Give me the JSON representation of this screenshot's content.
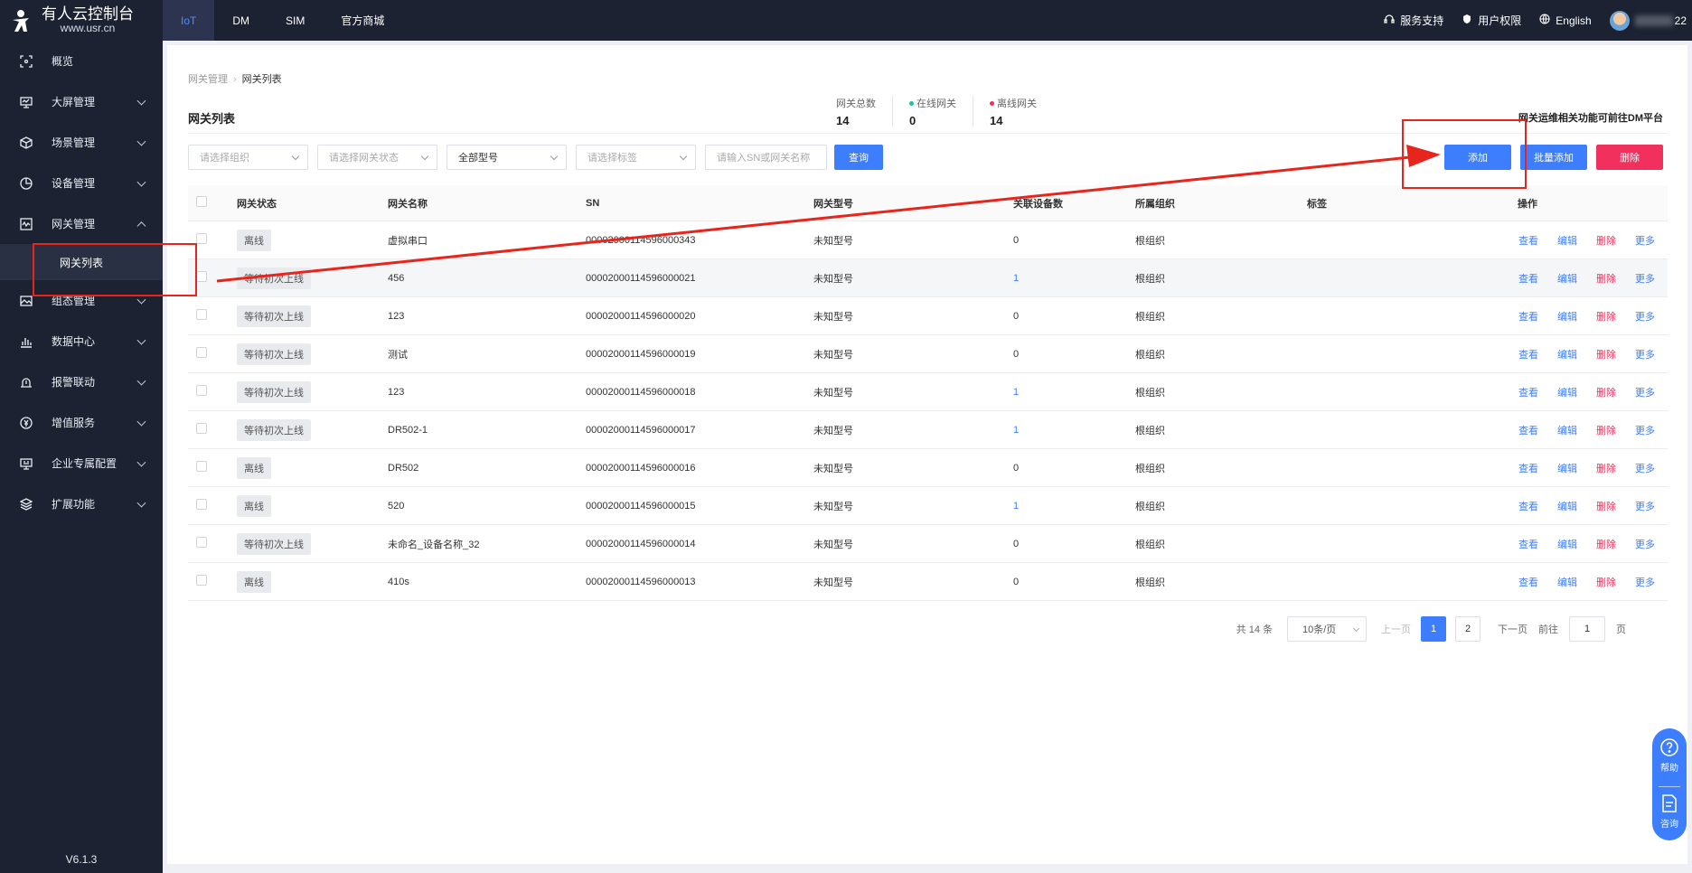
{
  "app": {
    "logo_title": "有人云控制台",
    "logo_url": "www.usr.cn",
    "version": "V6.1.3"
  },
  "sidebar": {
    "items": [
      {
        "label": "概览",
        "icon": "overview-icon",
        "arrow": false
      },
      {
        "label": "大屏管理",
        "icon": "monitor-icon",
        "arrow": true
      },
      {
        "label": "场景管理",
        "icon": "cube-icon",
        "arrow": true
      },
      {
        "label": "设备管理",
        "icon": "pie-chart-icon",
        "arrow": true
      },
      {
        "label": "网关管理",
        "icon": "gateway-icon",
        "arrow": true,
        "expanded": true
      },
      {
        "label": "组态管理",
        "icon": "image-icon",
        "arrow": true
      },
      {
        "label": "数据中心",
        "icon": "bar-chart-icon",
        "arrow": true
      },
      {
        "label": "报警联动",
        "icon": "alarm-icon",
        "arrow": true
      },
      {
        "label": "增值服务",
        "icon": "coin-icon",
        "arrow": true
      },
      {
        "label": "企业专属配置",
        "icon": "screen-config-icon",
        "arrow": true
      },
      {
        "label": "扩展功能",
        "icon": "layers-icon",
        "arrow": true
      }
    ],
    "submenu_active": "网关列表"
  },
  "topbar": {
    "tabs": [
      "IoT",
      "DM",
      "SIM",
      "官方商城"
    ],
    "active_tab": "IoT",
    "links": {
      "support": "服务支持",
      "permissions": "用户权限",
      "language": "English"
    },
    "username_suffix": "22"
  },
  "breadcrumb": {
    "parent": "网关管理",
    "current": "网关列表"
  },
  "page": {
    "title": "网关列表",
    "dm_note": "网关运维相关功能可前往DM平台"
  },
  "stats": [
    {
      "label": "网关总数",
      "value": "14",
      "dot": ""
    },
    {
      "label": "在线网关",
      "value": "0",
      "dot": "#19c39c"
    },
    {
      "label": "离线网关",
      "value": "14",
      "dot": "#f2305e"
    }
  ],
  "filters": {
    "org_placeholder": "请选择组织",
    "status_placeholder": "请选择网关状态",
    "model_value": "全部型号",
    "tag_placeholder": "请选择标签",
    "search_placeholder": "请输入SN或网关名称",
    "query_label": "查询"
  },
  "actions": {
    "add": "添加",
    "batch_add": "批量添加",
    "delete": "删除"
  },
  "table": {
    "columns": [
      "网关状态",
      "网关名称",
      "SN",
      "网关型号",
      "关联设备数",
      "所属组织",
      "标签",
      "操作"
    ],
    "rows": [
      {
        "status": "离线",
        "name": "虚拟串口",
        "sn": "00002000114596000343",
        "model": "未知型号",
        "count": "0",
        "org": "根组织",
        "tag": ""
      },
      {
        "status": "等待初次上线",
        "name": "456",
        "sn": "00002000114596000021",
        "model": "未知型号",
        "count": "1",
        "org": "根组织",
        "tag": ""
      },
      {
        "status": "等待初次上线",
        "name": "123",
        "sn": "00002000114596000020",
        "model": "未知型号",
        "count": "0",
        "org": "根组织",
        "tag": ""
      },
      {
        "status": "等待初次上线",
        "name": "测试",
        "sn": "00002000114596000019",
        "model": "未知型号",
        "count": "0",
        "org": "根组织",
        "tag": ""
      },
      {
        "status": "等待初次上线",
        "name": "123",
        "sn": "00002000114596000018",
        "model": "未知型号",
        "count": "1",
        "org": "根组织",
        "tag": ""
      },
      {
        "status": "等待初次上线",
        "name": "DR502-1",
        "sn": "00002000114596000017",
        "model": "未知型号",
        "count": "1",
        "org": "根组织",
        "tag": ""
      },
      {
        "status": "离线",
        "name": "DR502",
        "sn": "00002000114596000016",
        "model": "未知型号",
        "count": "0",
        "org": "根组织",
        "tag": ""
      },
      {
        "status": "离线",
        "name": "520",
        "sn": "00002000114596000015",
        "model": "未知型号",
        "count": "1",
        "org": "根组织",
        "tag": ""
      },
      {
        "status": "等待初次上线",
        "name": "未命名_设备名称_32",
        "sn": "00002000114596000014",
        "model": "未知型号",
        "count": "0",
        "org": "根组织",
        "tag": ""
      },
      {
        "status": "离线",
        "name": "410s",
        "sn": "00002000114596000013",
        "model": "未知型号",
        "count": "0",
        "org": "根组织",
        "tag": ""
      }
    ],
    "ops": [
      "查看",
      "编辑",
      "删除",
      "更多"
    ]
  },
  "pagination": {
    "total_text": "共 14 条",
    "page_size": "10条/页",
    "prev": "上一页",
    "pages": [
      "1",
      "2"
    ],
    "current_page": "1",
    "next": "下一页",
    "goto_prefix": "前往",
    "goto_value": "1",
    "goto_suffix": "页"
  },
  "float_help": {
    "help": "帮助",
    "consult": "咨询"
  },
  "colors": {
    "primary": "#3d7eff",
    "danger": "#f2305e",
    "sidebar_bg": "#1c2232",
    "annotation_red": "#e8251c"
  }
}
